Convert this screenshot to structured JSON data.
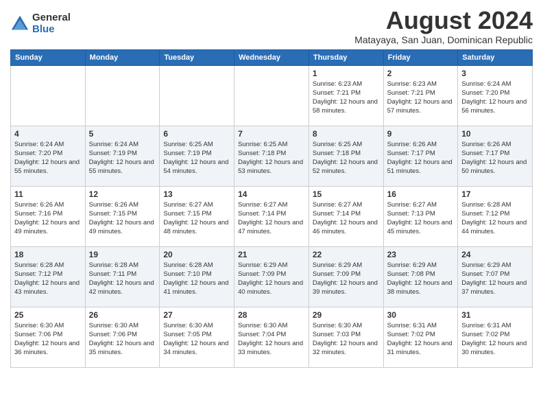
{
  "logo": {
    "general": "General",
    "blue": "Blue"
  },
  "header": {
    "month_year": "August 2024",
    "location": "Matayaya, San Juan, Dominican Republic"
  },
  "days_of_week": [
    "Sunday",
    "Monday",
    "Tuesday",
    "Wednesday",
    "Thursday",
    "Friday",
    "Saturday"
  ],
  "weeks": [
    [
      {
        "day": "",
        "info": ""
      },
      {
        "day": "",
        "info": ""
      },
      {
        "day": "",
        "info": ""
      },
      {
        "day": "",
        "info": ""
      },
      {
        "day": "1",
        "info": "Sunrise: 6:23 AM\nSunset: 7:21 PM\nDaylight: 12 hours and 58 minutes."
      },
      {
        "day": "2",
        "info": "Sunrise: 6:23 AM\nSunset: 7:21 PM\nDaylight: 12 hours and 57 minutes."
      },
      {
        "day": "3",
        "info": "Sunrise: 6:24 AM\nSunset: 7:20 PM\nDaylight: 12 hours and 56 minutes."
      }
    ],
    [
      {
        "day": "4",
        "info": "Sunrise: 6:24 AM\nSunset: 7:20 PM\nDaylight: 12 hours and 55 minutes."
      },
      {
        "day": "5",
        "info": "Sunrise: 6:24 AM\nSunset: 7:19 PM\nDaylight: 12 hours and 55 minutes."
      },
      {
        "day": "6",
        "info": "Sunrise: 6:25 AM\nSunset: 7:19 PM\nDaylight: 12 hours and 54 minutes."
      },
      {
        "day": "7",
        "info": "Sunrise: 6:25 AM\nSunset: 7:18 PM\nDaylight: 12 hours and 53 minutes."
      },
      {
        "day": "8",
        "info": "Sunrise: 6:25 AM\nSunset: 7:18 PM\nDaylight: 12 hours and 52 minutes."
      },
      {
        "day": "9",
        "info": "Sunrise: 6:26 AM\nSunset: 7:17 PM\nDaylight: 12 hours and 51 minutes."
      },
      {
        "day": "10",
        "info": "Sunrise: 6:26 AM\nSunset: 7:17 PM\nDaylight: 12 hours and 50 minutes."
      }
    ],
    [
      {
        "day": "11",
        "info": "Sunrise: 6:26 AM\nSunset: 7:16 PM\nDaylight: 12 hours and 49 minutes."
      },
      {
        "day": "12",
        "info": "Sunrise: 6:26 AM\nSunset: 7:15 PM\nDaylight: 12 hours and 49 minutes."
      },
      {
        "day": "13",
        "info": "Sunrise: 6:27 AM\nSunset: 7:15 PM\nDaylight: 12 hours and 48 minutes."
      },
      {
        "day": "14",
        "info": "Sunrise: 6:27 AM\nSunset: 7:14 PM\nDaylight: 12 hours and 47 minutes."
      },
      {
        "day": "15",
        "info": "Sunrise: 6:27 AM\nSunset: 7:14 PM\nDaylight: 12 hours and 46 minutes."
      },
      {
        "day": "16",
        "info": "Sunrise: 6:27 AM\nSunset: 7:13 PM\nDaylight: 12 hours and 45 minutes."
      },
      {
        "day": "17",
        "info": "Sunrise: 6:28 AM\nSunset: 7:12 PM\nDaylight: 12 hours and 44 minutes."
      }
    ],
    [
      {
        "day": "18",
        "info": "Sunrise: 6:28 AM\nSunset: 7:12 PM\nDaylight: 12 hours and 43 minutes."
      },
      {
        "day": "19",
        "info": "Sunrise: 6:28 AM\nSunset: 7:11 PM\nDaylight: 12 hours and 42 minutes."
      },
      {
        "day": "20",
        "info": "Sunrise: 6:28 AM\nSunset: 7:10 PM\nDaylight: 12 hours and 41 minutes."
      },
      {
        "day": "21",
        "info": "Sunrise: 6:29 AM\nSunset: 7:09 PM\nDaylight: 12 hours and 40 minutes."
      },
      {
        "day": "22",
        "info": "Sunrise: 6:29 AM\nSunset: 7:09 PM\nDaylight: 12 hours and 39 minutes."
      },
      {
        "day": "23",
        "info": "Sunrise: 6:29 AM\nSunset: 7:08 PM\nDaylight: 12 hours and 38 minutes."
      },
      {
        "day": "24",
        "info": "Sunrise: 6:29 AM\nSunset: 7:07 PM\nDaylight: 12 hours and 37 minutes."
      }
    ],
    [
      {
        "day": "25",
        "info": "Sunrise: 6:30 AM\nSunset: 7:06 PM\nDaylight: 12 hours and 36 minutes."
      },
      {
        "day": "26",
        "info": "Sunrise: 6:30 AM\nSunset: 7:06 PM\nDaylight: 12 hours and 35 minutes."
      },
      {
        "day": "27",
        "info": "Sunrise: 6:30 AM\nSunset: 7:05 PM\nDaylight: 12 hours and 34 minutes."
      },
      {
        "day": "28",
        "info": "Sunrise: 6:30 AM\nSunset: 7:04 PM\nDaylight: 12 hours and 33 minutes."
      },
      {
        "day": "29",
        "info": "Sunrise: 6:30 AM\nSunset: 7:03 PM\nDaylight: 12 hours and 32 minutes."
      },
      {
        "day": "30",
        "info": "Sunrise: 6:31 AM\nSunset: 7:02 PM\nDaylight: 12 hours and 31 minutes."
      },
      {
        "day": "31",
        "info": "Sunrise: 6:31 AM\nSunset: 7:02 PM\nDaylight: 12 hours and 30 minutes."
      }
    ]
  ]
}
